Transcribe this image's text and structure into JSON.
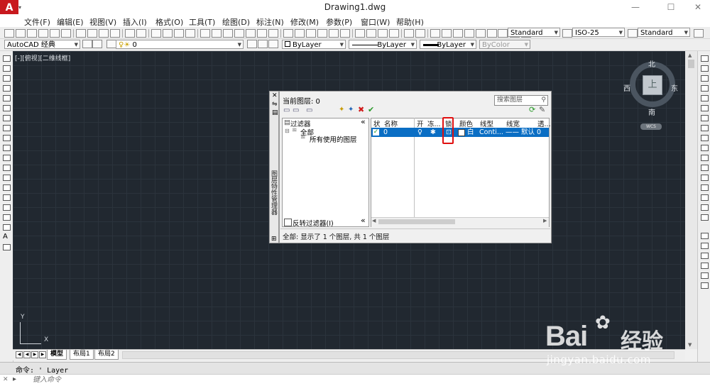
{
  "window": {
    "title": "Drawing1.dwg",
    "logo": "A",
    "logo_arrow": "▾",
    "minimize": "—",
    "maximize": "☐",
    "close": "✕"
  },
  "menu": [
    "文件(F)",
    "编辑(E)",
    "视图(V)",
    "插入(I)",
    "格式(O)",
    "工具(T)",
    "绘图(D)",
    "标注(N)",
    "修改(M)",
    "参数(P)",
    "窗口(W)",
    "帮助(H)"
  ],
  "toolbar1": {
    "text_style": "Standard",
    "dim_style": "ISO-25",
    "table_style": "Standard"
  },
  "toolbar2": {
    "workspace": "AutoCAD 经典",
    "layer": "0",
    "color": "ByLayer",
    "linetype": "ByLayer",
    "lineweight": "ByLayer",
    "plotstyle": "ByColor"
  },
  "viewport": {
    "label": "[-][俯视][二维线框]"
  },
  "viewcube": {
    "north": "北",
    "south": "南",
    "east": "东",
    "west": "西",
    "top": "上",
    "wcs": "WCS"
  },
  "ucs": {
    "x": "X",
    "y": "Y"
  },
  "layout_tabs": [
    "模型",
    "布局1",
    "布局2"
  ],
  "command": {
    "history": "命令: '_Layer",
    "prompt_icon": "▸",
    "placeholder": "键入命令"
  },
  "layer_dialog": {
    "side_title": "图层特性管理器",
    "current_layer": "当前图层: 0",
    "search_placeholder": "搜索图层",
    "search_icon": "magnifier-icon",
    "filter_header": "过滤器",
    "filter_all": "全部",
    "filter_used": "所有使用的图层",
    "invert_filter": "反转过滤器(I)",
    "collapse": "«",
    "columns": {
      "status": "状",
      "name": "名称",
      "on": "开",
      "freeze": "冻...",
      "lock": "锁",
      "color": "颜色",
      "linetype": "线型",
      "lineweight": "线宽",
      "transparency": "透..."
    },
    "row": {
      "name": "0",
      "color": "白",
      "linetype": "Conti...",
      "lineweight": "—— 默认",
      "transparency": "0"
    },
    "status_text": "全部: 显示了 1 个图层, 共 1 个图层"
  },
  "watermark": {
    "brand": "Bai",
    "brand2": "经验",
    "url": "jingyan.baidu.com"
  }
}
